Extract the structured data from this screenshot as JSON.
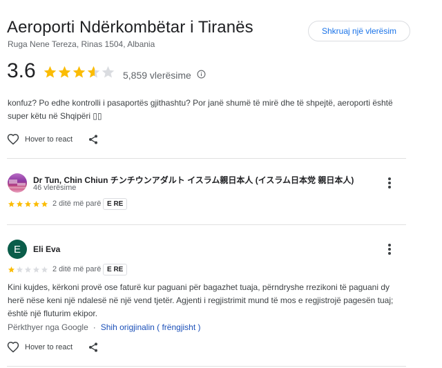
{
  "place": {
    "title": "Aeroporti Ndërkombëtar i Tiranës",
    "address": "Ruga Nene Tereza, Rinas 1504, Albania",
    "write_review_label": "Shkruaj një vlerësim",
    "rating": "3.6",
    "rating_value": 3.6,
    "review_count": "5,859 vlerësime"
  },
  "colors": {
    "star": "#fbbc04",
    "star_empty": "#dadce0",
    "link": "#1a73e8"
  },
  "reviews": [
    {
      "text": "konfuz? Po edhe kontrolli i pasaportës gjithashtu? Por janë shumë të mirë dhe të shpejtë, aeroporti është super këtu në Shqipëri ▯▯",
      "react_label": "Hover to react"
    },
    {
      "author": "Dr Tun, Chin Chiun チンチウンアダルト イスラム親日本人 (イスラム日本党 親日本人)",
      "meta": "46 vlerësime",
      "stars": 5,
      "date": "2 ditë më parë",
      "badge": "E RE"
    },
    {
      "avatar_letter": "E",
      "author": "Eli Eva",
      "stars": 1,
      "date": "2 ditë më parë",
      "badge": "E RE",
      "text": "Kini kujdes, kërkoni provë ose faturë kur paguani për bagazhet tuaja, përndryshe rrezikoni të paguani dy herë nëse keni një ndalesë në një vend tjetër. Agjenti i regjistrimit mund të mos e regjistrojë pagesën tuaj; është një fluturim ekipor.",
      "translated_label": "Përkthyer nga Google",
      "separator": "·",
      "original_link": "Shih origjinalin ( frëngjisht )",
      "react_label": "Hover to react"
    }
  ]
}
